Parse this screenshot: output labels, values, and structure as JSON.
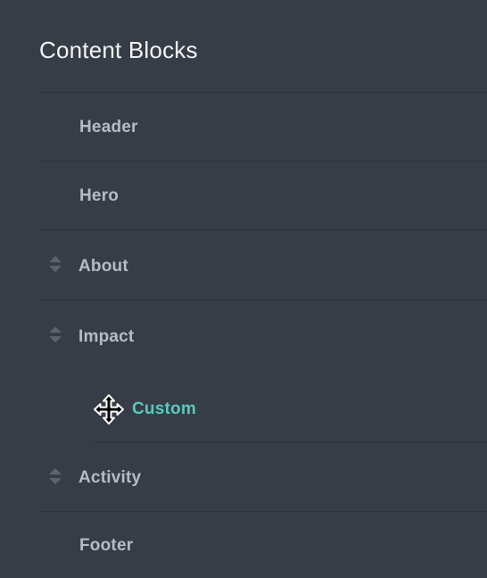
{
  "panel": {
    "title": "Content Blocks"
  },
  "blocks": [
    {
      "label": "Header",
      "sortable": false
    },
    {
      "label": "Hero",
      "sortable": false
    },
    {
      "label": "About",
      "sortable": true
    },
    {
      "label": "Impact",
      "sortable": true
    },
    {
      "label": "Custom",
      "sortable": false,
      "nested": true,
      "active": true,
      "dragging": true
    },
    {
      "label": "Activity",
      "sortable": true
    },
    {
      "label": "Footer",
      "sortable": false
    }
  ],
  "icons": {
    "sort_handle": "sort-handle-icon",
    "drag_cursor": "move-cursor-icon"
  },
  "colors": {
    "background": "#373d46",
    "divider": "#2c3138",
    "title": "#f1f3f5",
    "label": "#b6bcc3",
    "active_label": "#58c9bd",
    "handle": "#5c636c"
  }
}
